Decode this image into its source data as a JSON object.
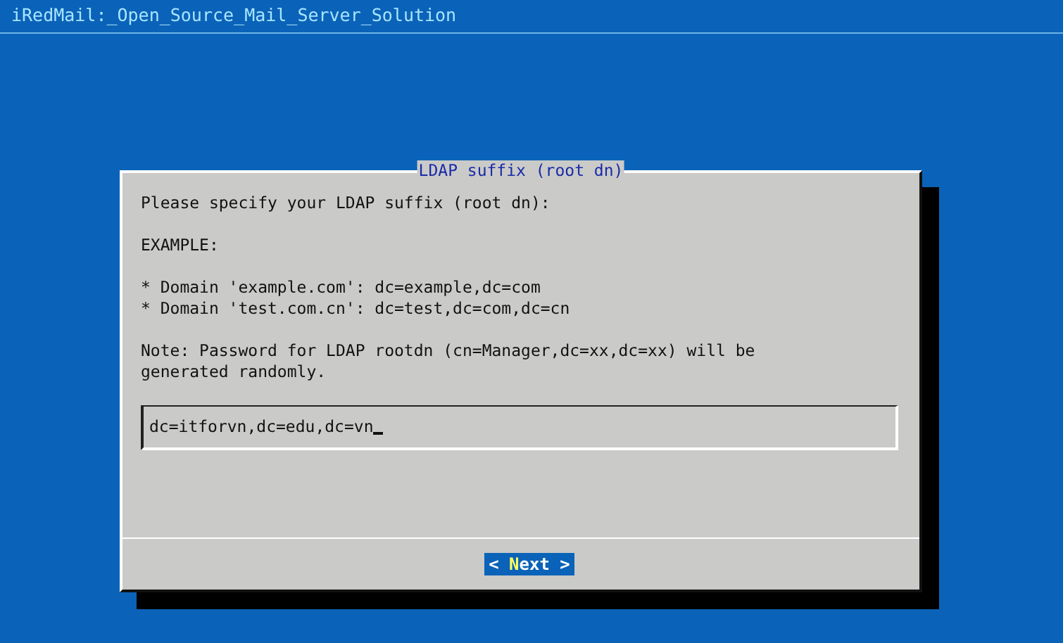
{
  "screen_title": "iRedMail:_Open_Source_Mail_Server_Solution",
  "dialog": {
    "title": "LDAP suffix (root dn)",
    "paragraphs": [
      [
        "Please specify your LDAP suffix (root dn):"
      ],
      [
        "EXAMPLE:"
      ],
      [
        "* Domain 'example.com': dc=example,dc=com",
        "* Domain 'test.com.cn': dc=test,dc=com,dc=cn"
      ],
      [
        "Note: Password for LDAP rootdn (cn=Manager,dc=xx,dc=xx) will be generated randomly."
      ]
    ],
    "input": {
      "value": "dc=itforvn,dc=edu,dc=vn",
      "focused": true
    },
    "buttons": [
      {
        "before": "< ",
        "hotkey": "N",
        "after": "ext >",
        "selected": true
      }
    ]
  }
}
